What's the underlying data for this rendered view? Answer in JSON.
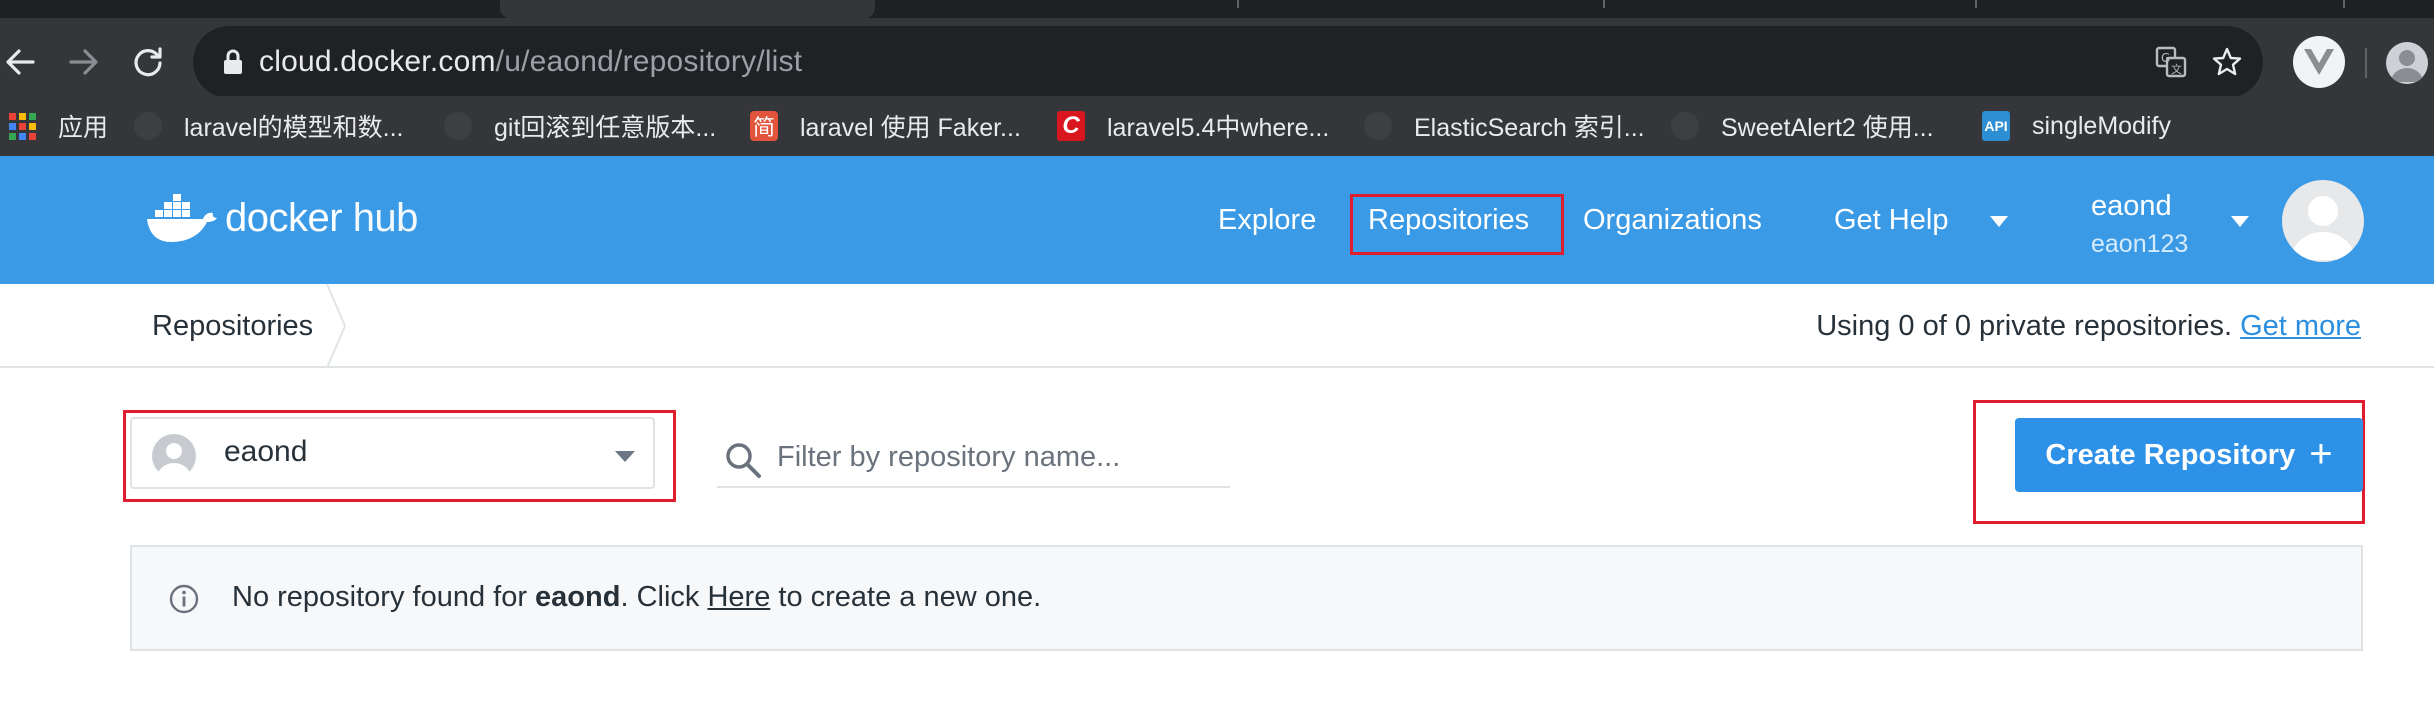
{
  "browser": {
    "url_host": "cloud.docker.com",
    "url_path": "/u/eaond/repository/list",
    "bookmarks": [
      {
        "label": "应用",
        "icon": "apps-grid-icon"
      },
      {
        "label": "laravel的模型和数...",
        "icon": "site-icon"
      },
      {
        "label": "git回滚到任意版本...",
        "icon": "site-icon"
      },
      {
        "label": "laravel 使用 Faker...",
        "icon": "jianshu-icon"
      },
      {
        "label": "laravel5.4中where...",
        "icon": "csdn-icon"
      },
      {
        "label": "ElasticSearch 索引...",
        "icon": "site-icon"
      },
      {
        "label": "SweetAlert2 使用...",
        "icon": "site-icon"
      },
      {
        "label": "singleModify",
        "icon": "api-icon"
      }
    ],
    "bookmark_jian_glyph": "简",
    "bookmark_csdn_glyph": "C",
    "bookmark_api_glyph": "API"
  },
  "header": {
    "logo_text_docker": "docker",
    "logo_text_hub": "hub",
    "nav": {
      "explore": "Explore",
      "repositories": "Repositories",
      "organizations": "Organizations",
      "get_help": "Get Help"
    },
    "user": {
      "name": "eaond",
      "sub": "eaon123"
    }
  },
  "breadcrumb": {
    "current": "Repositories",
    "usage_text": "Using 0 of 0 private repositories.",
    "get_more": "Get more"
  },
  "controls": {
    "namespace_selected": "eaond",
    "filter_placeholder": "Filter by repository name...",
    "create_button": "Create Repository",
    "create_plus": "+"
  },
  "empty_state": {
    "prefix": "No repository found for",
    "name": "eaond",
    "middle": ". Click",
    "link": "Here",
    "suffix": "to create a new one."
  },
  "colors": {
    "brand_blue": "#2496ed",
    "highlight_red": "#e01d2f",
    "browser_dark": "#35363a"
  }
}
